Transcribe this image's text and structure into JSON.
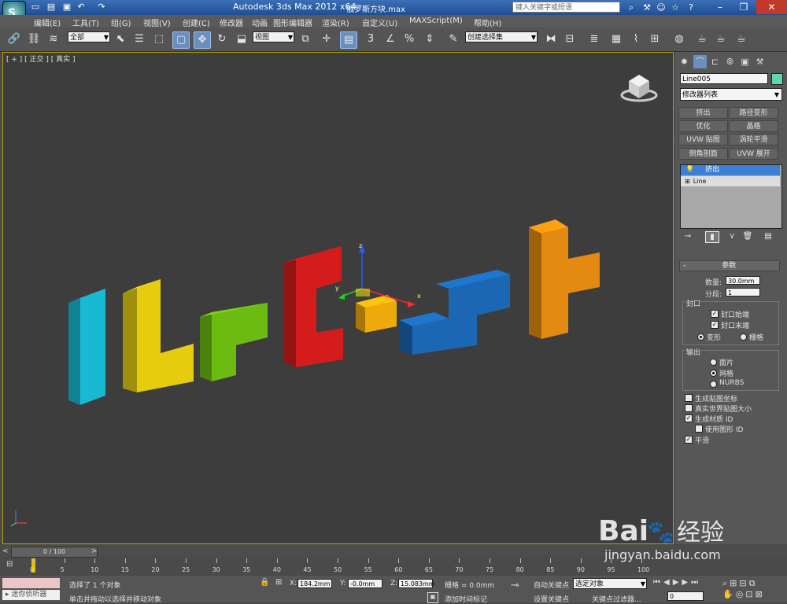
{
  "window": {
    "app_title": "Autodesk 3ds Max  2012 x64",
    "file_title": "俄罗斯方块.max",
    "search_placeholder": "键入关键字或短语"
  },
  "menu": [
    "编辑(E)",
    "工具(T)",
    "组(G)",
    "视图(V)",
    "创建(C)",
    "修改器",
    "动画",
    "图形编辑器",
    "渲染(R)",
    "自定义(U)",
    "MAXScript(M)",
    "帮助(H)"
  ],
  "toolbar": {
    "selection_filter": "全部",
    "ref_coord": "视图",
    "named_selection": "创建选择集",
    "snap_angle_label": "3",
    "percent_label": "%"
  },
  "viewport": {
    "label": "[ + ] [ 正交 ] [ 真实 ]",
    "gizmo_x": "x",
    "gizmo_y": "y",
    "gizmo_z": "z",
    "block_colors": [
      "#17b9d3",
      "#e5cc0f",
      "#6cbb13",
      "#d41c1c",
      "#eeaa0c",
      "#1b67b4",
      "#e48a10"
    ]
  },
  "command_panel": {
    "object_name": "Line005",
    "object_color": "#5fd6b3",
    "modifier_list": "修改器列表",
    "modifier_buttons": [
      "挤出",
      "路径变形",
      "优化",
      "晶格",
      "UVW 贴图",
      "涡轮平滑",
      "倒角剖面",
      "UVW 展开"
    ],
    "stack": [
      "挤出",
      "Line"
    ],
    "params": {
      "title": "参数",
      "amount_label": "数量:",
      "amount_value": "30.0mm",
      "segments_label": "分段:",
      "segments_value": "1",
      "cap_group": "封口",
      "cap_start": "封口始端",
      "cap_end": "封口末端",
      "morph": "变形",
      "grid": "栅格",
      "output_group": "输出",
      "patch": "面片",
      "mesh": "网格",
      "nurbs": "NURBS",
      "gen_map_coords": "生成贴图坐标",
      "real_world": "真实世界贴图大小",
      "gen_mat_id": "生成材质 ID",
      "use_shape_id": "使用图形 ID",
      "smooth": "平滑"
    }
  },
  "timeline": {
    "frame_display": "0 / 100",
    "ticks": [
      "0",
      "5",
      "10",
      "15",
      "20",
      "25",
      "30",
      "35",
      "40",
      "45",
      "50",
      "55",
      "60",
      "65",
      "70",
      "75",
      "80",
      "85",
      "90",
      "95",
      "100"
    ]
  },
  "status": {
    "listener_text": "迷你侦听器",
    "selection_status": "选择了 1 个对象",
    "prompt": "单击并拖动以选择并移动对象",
    "x_label": "X:",
    "x_value": "184.2mm",
    "y_label": "Y:",
    "y_value": "-0.0mm",
    "z_label": "Z:",
    "z_value": "15.083mm",
    "grid_value": "栅格 = 0.0mm",
    "add_time_tag": "添加时间标记",
    "auto_key": "自动关键点",
    "auto_key_mode": "选定对象",
    "set_key": "设置关键点",
    "key_filters": "关键点过滤器...",
    "current_frame": "0"
  },
  "watermark": {
    "logo": "Bai",
    "logo_cn": "经验",
    "url": "jingyan.baidu.com"
  }
}
